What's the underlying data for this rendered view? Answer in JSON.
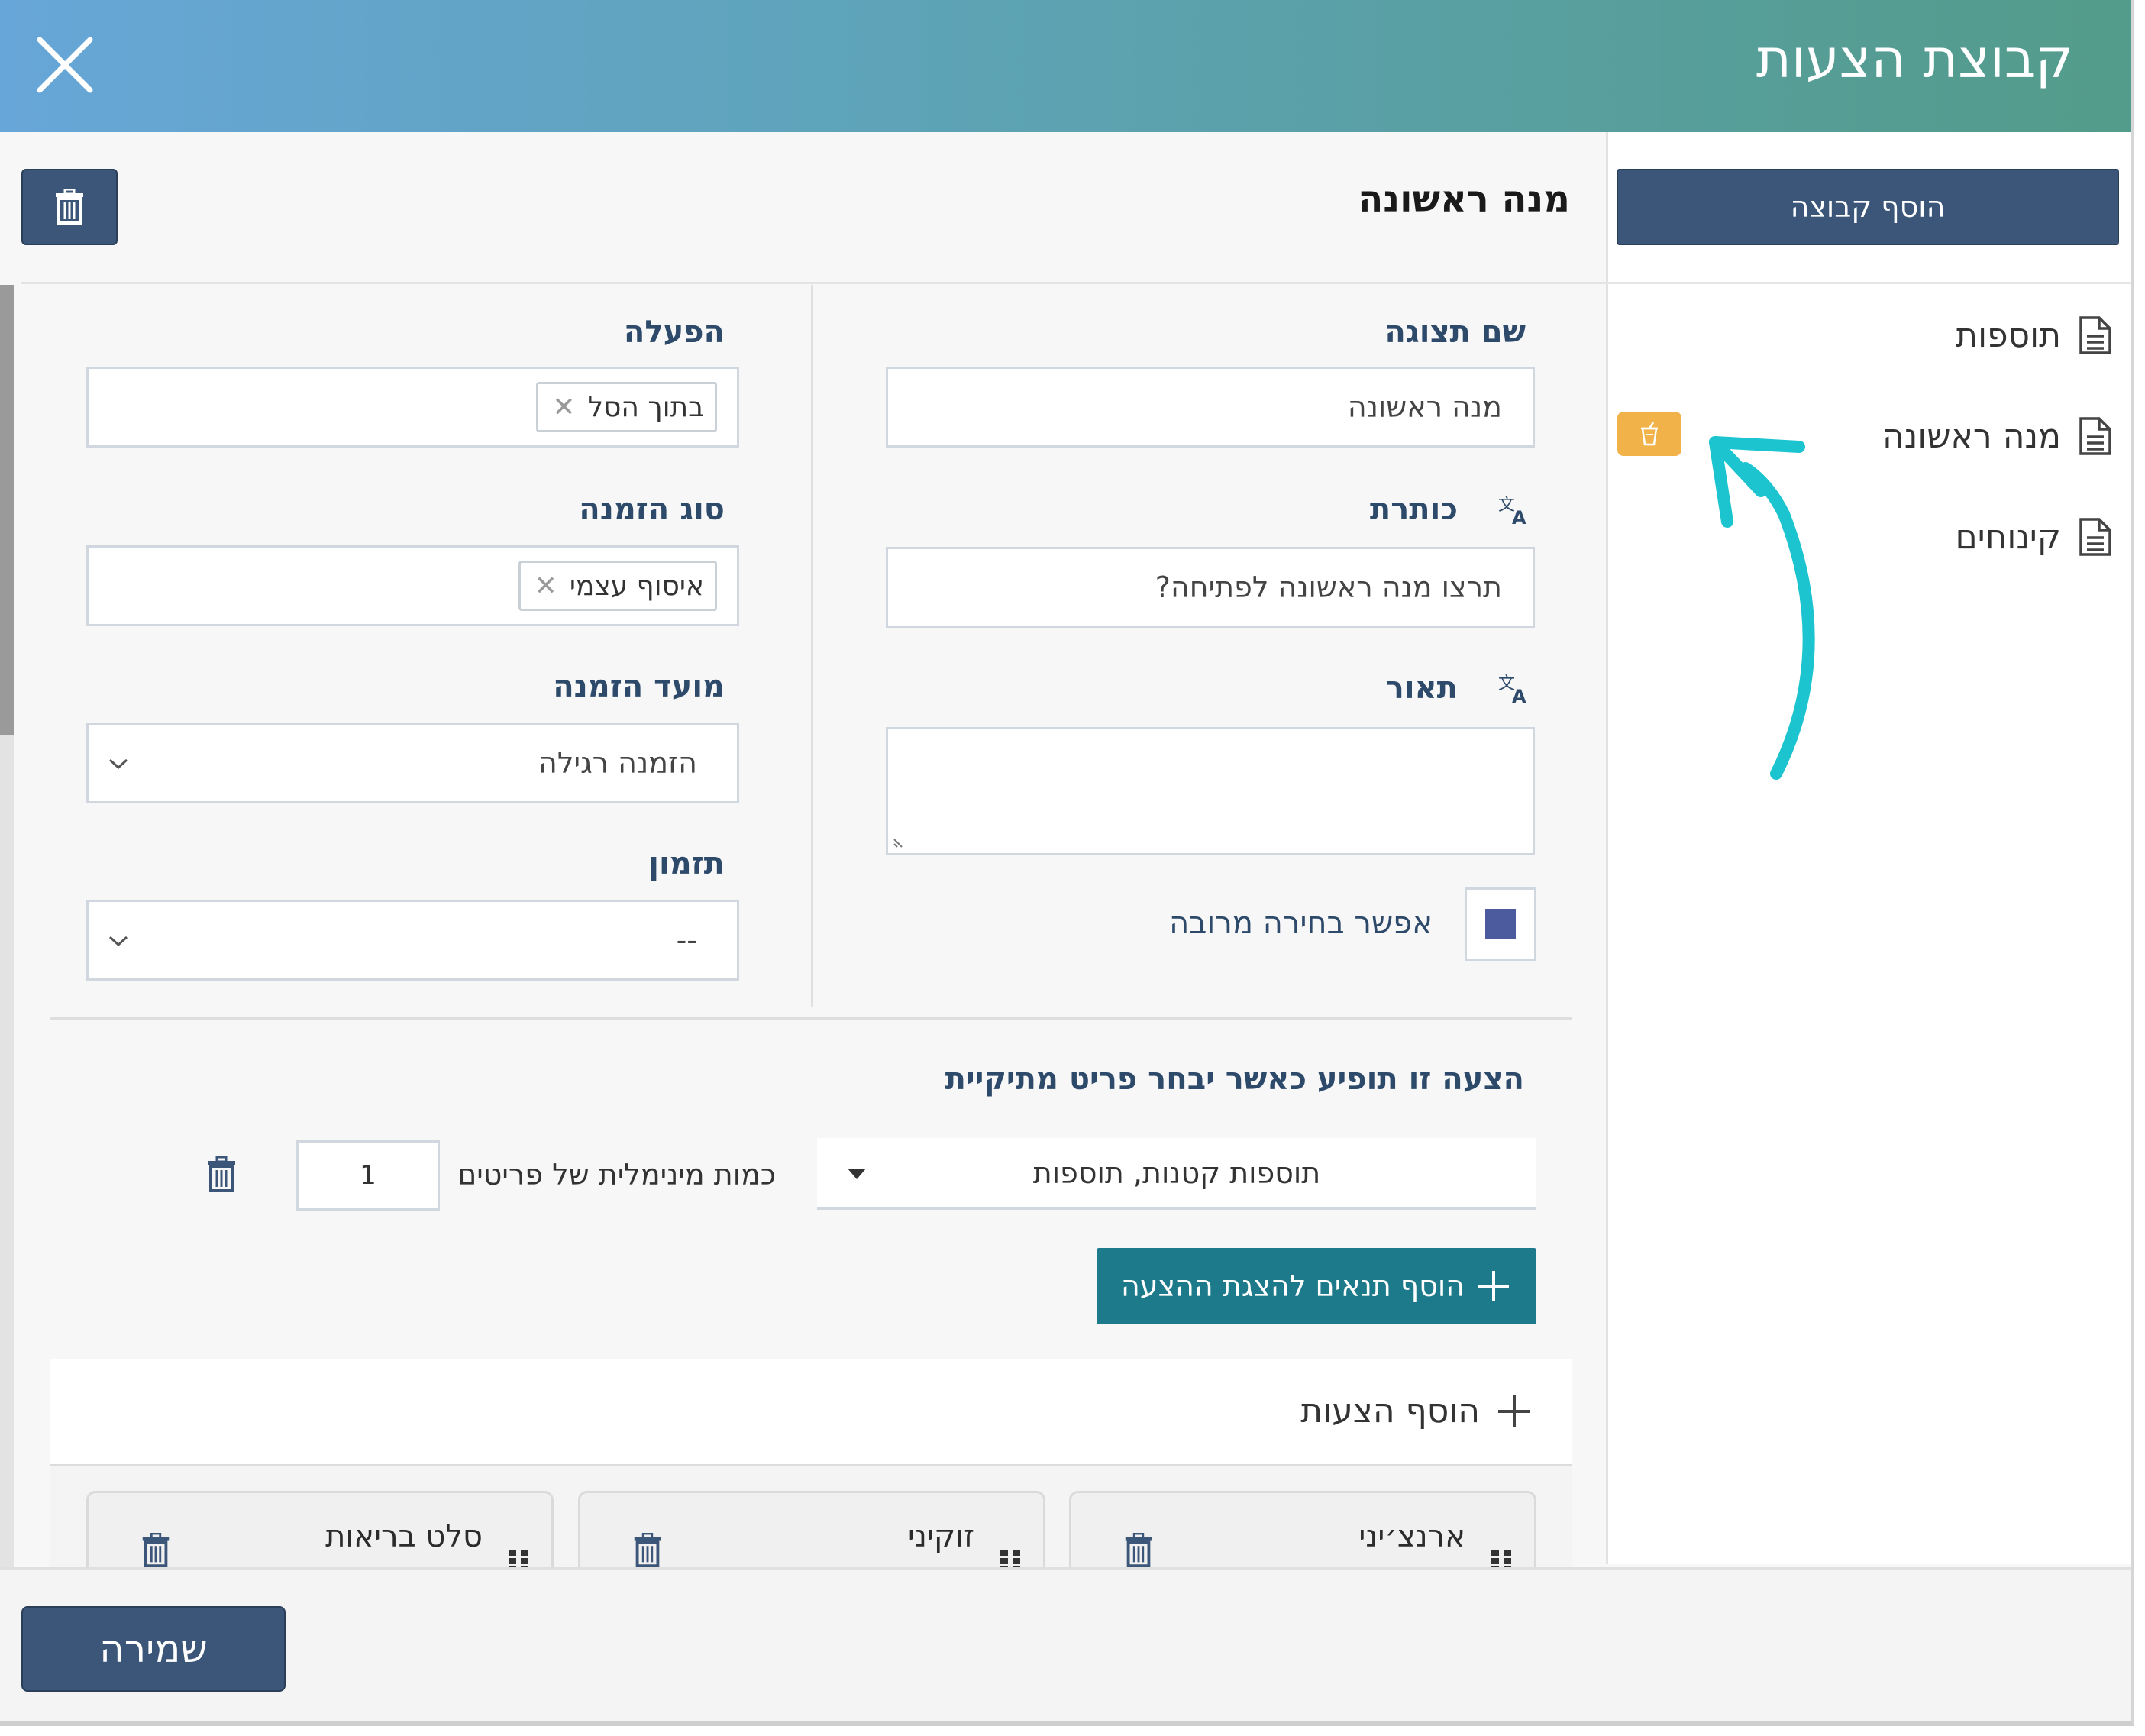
{
  "header": {
    "title": "קבוצת הצעות"
  },
  "sidebar": {
    "add_group_label": "הוסף קבוצה",
    "items": [
      {
        "label": "תוספות"
      },
      {
        "label": "מנה ראשונה"
      },
      {
        "label": "קינוחים"
      }
    ]
  },
  "group": {
    "name": "מנה ראשונה"
  },
  "form": {
    "display_name": {
      "label": "שם תצוגה",
      "value": "מנה ראשונה"
    },
    "heading": {
      "label": "כותרת",
      "value": "תרצו מנה ראשונה לפתיחה?"
    },
    "description": {
      "label": "תאור",
      "value": ""
    },
    "multi_select": {
      "label": "אפשר בחירה מרובה",
      "checked": true
    },
    "activation": {
      "label": "הפעלה",
      "tag": "בתוך הסל"
    },
    "order_type": {
      "label": "סוג הזמנה",
      "tag": "איסוף עצמי"
    },
    "order_time": {
      "label": "מועד הזמנה",
      "value": "הזמנה רגילה"
    },
    "timing": {
      "label": "תזמון",
      "value": "--"
    }
  },
  "condition": {
    "title": "הצעה זו תופיע כאשר יבחר פריט מתיקיית",
    "folder_value": "תוספות קטנות, תוספות",
    "min_qty_label": "כמות מינימלית של פריטים",
    "min_qty_value": "1",
    "add_condition_label": "הוסף תנאים להצגת ההצעה"
  },
  "offers": {
    "add_label": "הוסף הצעות",
    "cards": [
      {
        "name": "ארנצ׳יני"
      },
      {
        "name": "זוקיני"
      },
      {
        "name": "סלט בריאות"
      }
    ]
  },
  "footer": {
    "save_label": "שמירה"
  },
  "colors": {
    "primary": "#3b5678",
    "teal": "#1d7a8a",
    "badge": "#f2b24a",
    "arrow": "#1cc4cf",
    "label": "#2e4a6b"
  }
}
